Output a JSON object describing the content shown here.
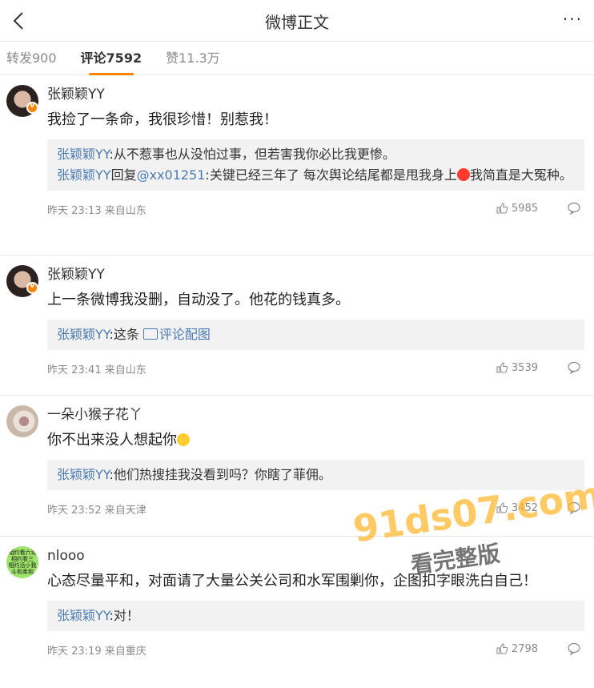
{
  "header": {
    "title": "微博正文",
    "more": "···"
  },
  "tabs": [
    {
      "label": "转发900"
    },
    {
      "label": "评论7592"
    },
    {
      "label": "赞11.3万"
    }
  ],
  "comments": [
    {
      "name": "张颖颖YY",
      "text": "我捡了一条命，我很珍惜！别惹我！",
      "replies": [
        {
          "user": "张颖颖YY",
          "text": ":从不惹事也从没怕过事，但若害我你必比我更惨。"
        },
        {
          "user": "张颖颖YY",
          "mid": "回复",
          "mention": "@xx01251",
          "text": ":关键已经三年了 每次舆论结尾都是甩我身上",
          "text2": "我简直是大冤种。"
        }
      ],
      "time": "昨天 23:13 来自山东",
      "likes": "5985"
    },
    {
      "name": "张颖颖YY",
      "text": "上一条微博我没删，自动没了。他花的钱真多。",
      "replies": [
        {
          "user": "张颖颖YY",
          "text": ":这条 ",
          "link": "评论配图"
        }
      ],
      "time": "昨天 23:41 来自山东",
      "likes": "3539"
    },
    {
      "name": "一朵小猴子花丫",
      "text": "你不出来没人想起你",
      "replies": [
        {
          "user": "张颖颖YY",
          "text": ":他们热搜挂我没看到吗？你瞎了菲佣。"
        }
      ],
      "time": "昨天 23:52 来自天津",
      "likes": "3452"
    },
    {
      "name": "nlooo",
      "avatar_text": "相约看六论 相约看三 相约活小我 斗和柔和",
      "text": "心态尽量平和，对面请了大量公关公司和水军围剿你，企图扣字眼洗白自己！",
      "replies": [
        {
          "user": "张颖颖YY",
          "text": ":对！"
        }
      ],
      "time": "昨天 23:19 来自重庆",
      "likes": "2798"
    }
  ],
  "watermark": {
    "main": "91ds07.com",
    "sub": "看完整版"
  },
  "colors": {
    "accent": "#ff8200",
    "link": "#4a7ab0",
    "quote_bg": "#f2f2f2"
  }
}
